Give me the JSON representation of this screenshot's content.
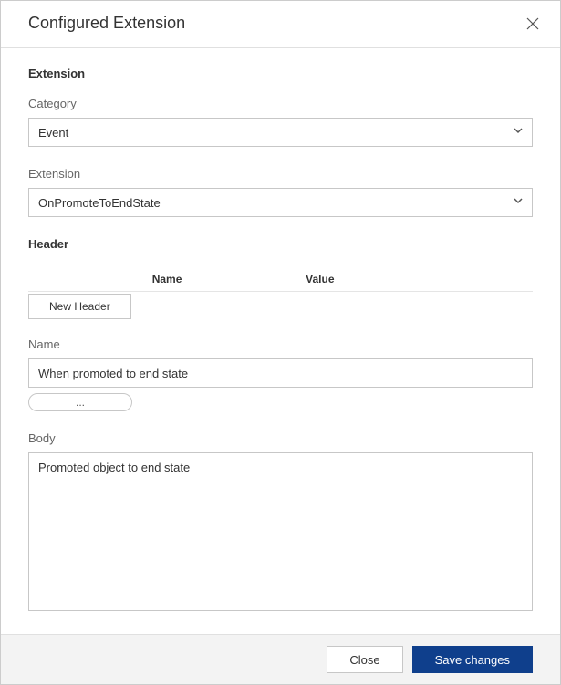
{
  "dialog": {
    "title": "Configured Extension"
  },
  "extension": {
    "section_title": "Extension",
    "category_label": "Category",
    "category_value": "Event",
    "extension_label": "Extension",
    "extension_value": "OnPromoteToEndState"
  },
  "header": {
    "section_title": "Header",
    "col_name": "Name",
    "col_value": "Value",
    "new_header_button": "New Header"
  },
  "name_field": {
    "label": "Name",
    "value": "When promoted to end state",
    "more_button": "..."
  },
  "body_field": {
    "label": "Body",
    "value": "Promoted object to end state"
  },
  "footer": {
    "close": "Close",
    "save": "Save changes"
  }
}
